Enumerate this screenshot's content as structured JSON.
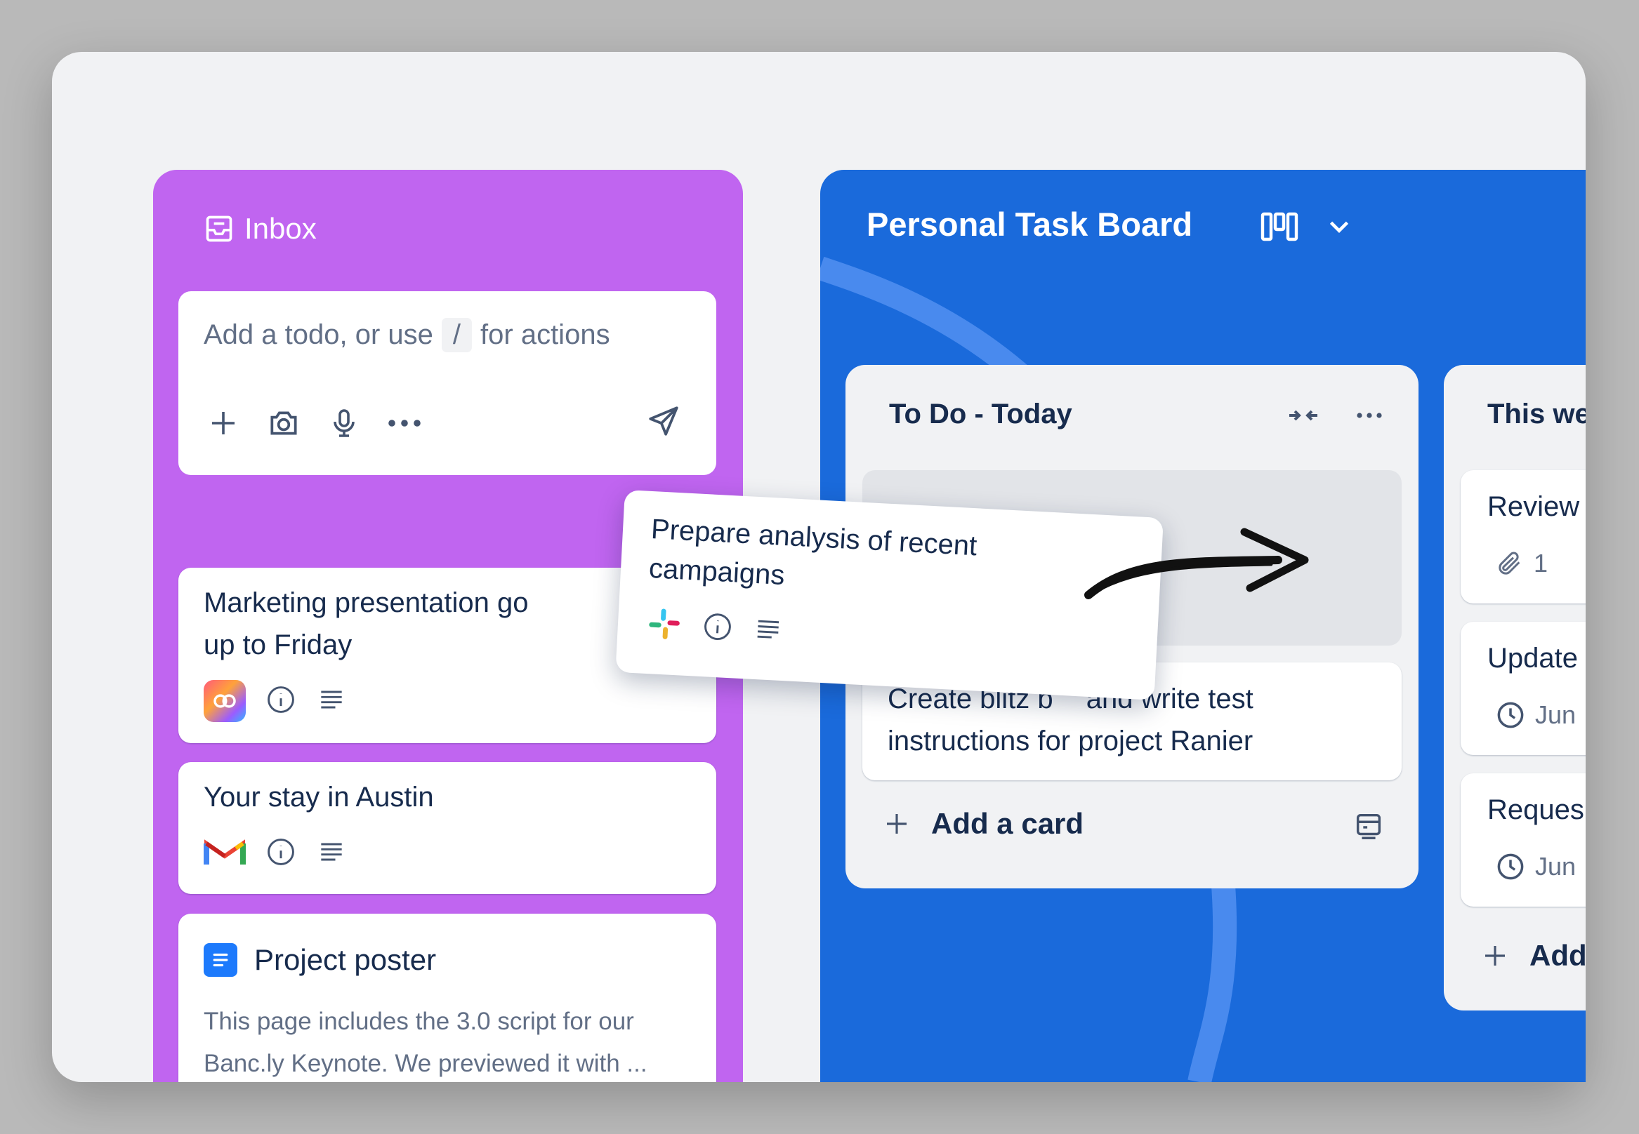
{
  "inbox": {
    "title": "Inbox",
    "composer": {
      "placeholder_before": "Add a todo, or use",
      "slash": "/",
      "placeholder_after": "for actions"
    },
    "cards": [
      {
        "text_line1": "Marketing presentation go",
        "text_line2": "up to Friday",
        "source_icon": "creative-cloud-icon"
      },
      {
        "text": "Your stay in Austin",
        "source_icon": "gmail-icon"
      },
      {
        "title": "Project poster",
        "desc_line1": "This page includes the 3.0 script for our",
        "desc_line2": "Banc.ly Keynote. We previewed it with ...",
        "source_icon": "confluence-page-icon"
      }
    ]
  },
  "board": {
    "title": "Personal Task Board",
    "lists": [
      {
        "title": "To Do - Today",
        "cards": [
          {
            "text_line1": "Create blitz b",
            "text_line1b": "and write test",
            "text_line2": "instructions for project Ranier"
          }
        ],
        "add_label": "Add a card"
      },
      {
        "title": "This we",
        "cards": [
          {
            "text": "Review",
            "meta": "1",
            "meta_icon": "paperclip-icon"
          },
          {
            "text": "Update",
            "meta": "Jun",
            "meta_icon": "clock-icon"
          },
          {
            "text": "Reques",
            "meta": "Jun",
            "meta_icon": "clock-icon"
          }
        ],
        "add_label": "Add"
      }
    ]
  },
  "drag_card": {
    "line1": "Prepare analysis of recent",
    "line2": "campaigns",
    "source_icon": "slack-icon"
  },
  "colors": {
    "inbox_bg": "#c065f0",
    "board_bg": "#1a6adb",
    "text": "#172b4d"
  }
}
